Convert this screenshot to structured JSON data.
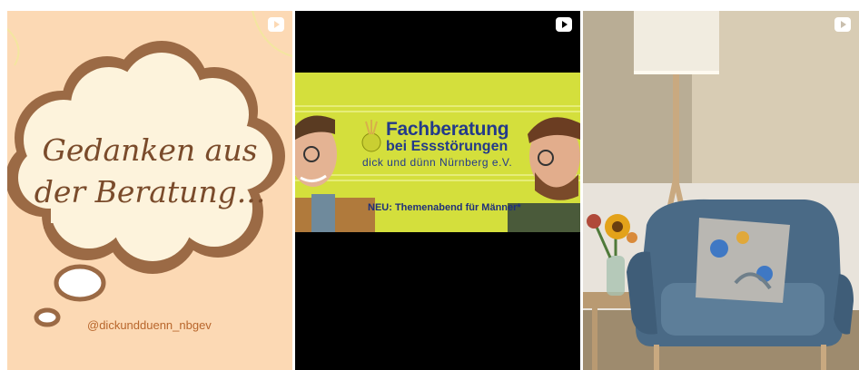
{
  "tiles": [
    {
      "name": "gedanken-tile",
      "headline_line1": "Gedanken aus",
      "headline_line2": "der Beratung...",
      "handle": "@dickundduenn_nbgev",
      "media_icon": "play-icon"
    },
    {
      "name": "fachberatung-tile",
      "title": "Fachberatung",
      "subtitle": "bei Essstörungen",
      "organization": "dick und dünn Nürnberg e.V.",
      "announcement": "NEU: Themenabend für Männer*",
      "media_icon": "play-icon"
    },
    {
      "name": "room-photo-tile",
      "media_icon": "play-icon"
    }
  ],
  "colors": {
    "peach": "#fcd9b4",
    "cloud_brown": "#9b6a45",
    "cloud_fill": "#fdf3dc",
    "banner_lime": "#d4df3c",
    "banner_blue": "#233a8a"
  }
}
